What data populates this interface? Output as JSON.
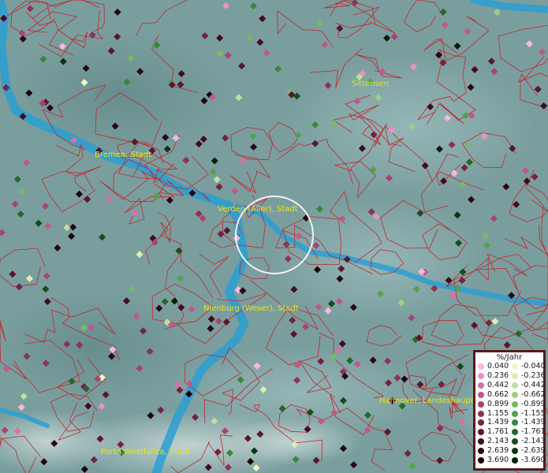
{
  "map": {
    "cities": [
      "Bremen, Stadt",
      "Verden (Aller), Stadt",
      "Sittensen",
      "Nienburg (Weser), Stadt",
      "Hannover, Landeshauptstadt",
      "Porta Westfalica, Stadt"
    ],
    "colors": {
      "background": "#7a9e9e",
      "river": "#2b9fd2",
      "borders": "#c0282e",
      "label": "#e6e61a",
      "ring": "#f2f2f2"
    }
  },
  "legend": {
    "title": "%/Jahr",
    "positive": [
      {
        "label": "0.040",
        "color": "#f7b8e2"
      },
      {
        "label": "0.236",
        "color": "#e893c2"
      },
      {
        "label": "0.442",
        "color": "#d572a5"
      },
      {
        "label": "0.662",
        "color": "#c2588a"
      },
      {
        "label": "0.899",
        "color": "#a84470"
      },
      {
        "label": "1.155",
        "color": "#8e3157"
      },
      {
        "label": "1.439",
        "color": "#732243"
      },
      {
        "label": "1.761",
        "color": "#5a1530"
      },
      {
        "label": "2.143",
        "color": "#430b21"
      },
      {
        "label": "2.639",
        "color": "#2e0515"
      },
      {
        "label": "3.690",
        "color": "#1a020a"
      }
    ],
    "negative": [
      {
        "label": "-0.040",
        "color": "#f2f7bd"
      },
      {
        "label": "-0.236",
        "color": "#dcefb1"
      },
      {
        "label": "-0.442",
        "color": "#bfe09c"
      },
      {
        "label": "-0.662",
        "color": "#9fcd85"
      },
      {
        "label": "-0.899",
        "color": "#7ab86a"
      },
      {
        "label": "-1.155",
        "color": "#56a04f"
      },
      {
        "label": "-1.439",
        "color": "#3a863a"
      },
      {
        "label": "-1.761",
        "color": "#24692a"
      },
      {
        "label": "-2.143",
        "color": "#144e1c"
      },
      {
        "label": "-2.639",
        "color": "#093611"
      },
      {
        "label": "-3.690",
        "color": "#031f08"
      }
    ]
  }
}
